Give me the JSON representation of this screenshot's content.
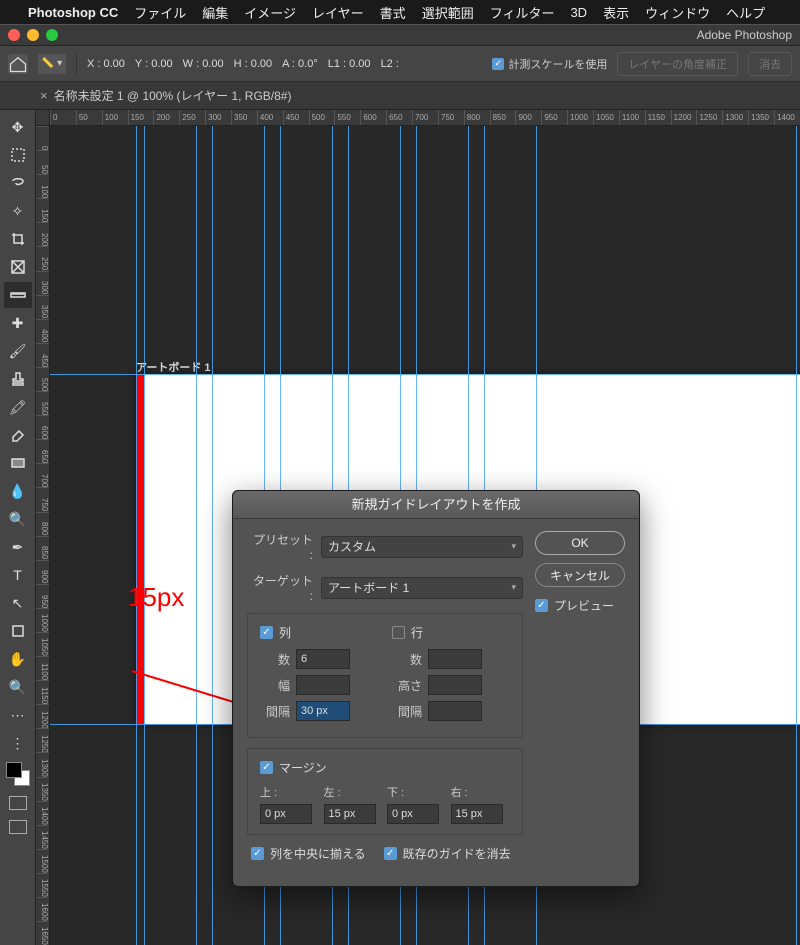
{
  "menubar": {
    "app": "Photoshop CC",
    "items": [
      "ファイル",
      "編集",
      "イメージ",
      "レイヤー",
      "書式",
      "選択範囲",
      "フィルター",
      "3D",
      "表示",
      "ウィンドウ",
      "ヘルプ"
    ]
  },
  "window": {
    "title": "Adobe Photoshop"
  },
  "optbar": {
    "x": "X : 0.00",
    "y": "Y : 0.00",
    "w": "W : 0.00",
    "h": "H : 0.00",
    "a": "A : 0.0°",
    "l1": "L1 : 0.00",
    "l2": "L2 :",
    "scale_label": "計測スケールを使用",
    "layer_btn": "レイヤーの角度補正",
    "clear_btn": "消去"
  },
  "doctab": {
    "title": "名称未設定 1 @ 100% (レイヤー 1, RGB/8#)"
  },
  "ruler_h": [
    "0",
    "50",
    "100",
    "150",
    "200",
    "250",
    "300",
    "350",
    "400",
    "450",
    "500",
    "550",
    "600",
    "650",
    "700",
    "750",
    "800",
    "850",
    "900",
    "950",
    "1000",
    "1050",
    "1100",
    "1150",
    "1200",
    "1250",
    "1300",
    "1350",
    "1400"
  ],
  "ruler_v": [
    "0",
    "50",
    "100",
    "150",
    "200",
    "250",
    "300",
    "350",
    "400",
    "450",
    "500",
    "550",
    "600",
    "650",
    "700",
    "750",
    "800",
    "850",
    "900",
    "950",
    "1000",
    "1050",
    "1100",
    "1150",
    "1200",
    "1250",
    "1300",
    "1350",
    "1400",
    "1450",
    "1500",
    "1550",
    "1600",
    "1650"
  ],
  "artboard": {
    "label": "アートボード 1"
  },
  "annotation": {
    "text": "15px"
  },
  "dialog": {
    "title": "新規ガイドレイアウトを作成",
    "preset_label": "プリセット :",
    "preset_value": "カスタム",
    "target_label": "ターゲット :",
    "target_value": "アートボード 1",
    "ok": "OK",
    "cancel": "キャンセル",
    "preview": "プレビュー",
    "col_title": "列",
    "row_title": "行",
    "count_label": "数",
    "count_value": "6",
    "width_label": "幅",
    "width_value": "",
    "gutter_label": "間隔",
    "gutter_value": "30 px",
    "row_count_label": "数",
    "row_height_label": "高さ",
    "row_gutter_label": "間隔",
    "margin_title": "マージン",
    "m_top": "上 :",
    "m_left": "左 :",
    "m_bottom": "下 :",
    "m_right": "右 :",
    "m_top_v": "0 px",
    "m_left_v": "15 px",
    "m_bottom_v": "0 px",
    "m_right_v": "15 px",
    "center_cols": "列を中央に揃える",
    "clear_guides": "既存のガイドを消去"
  }
}
